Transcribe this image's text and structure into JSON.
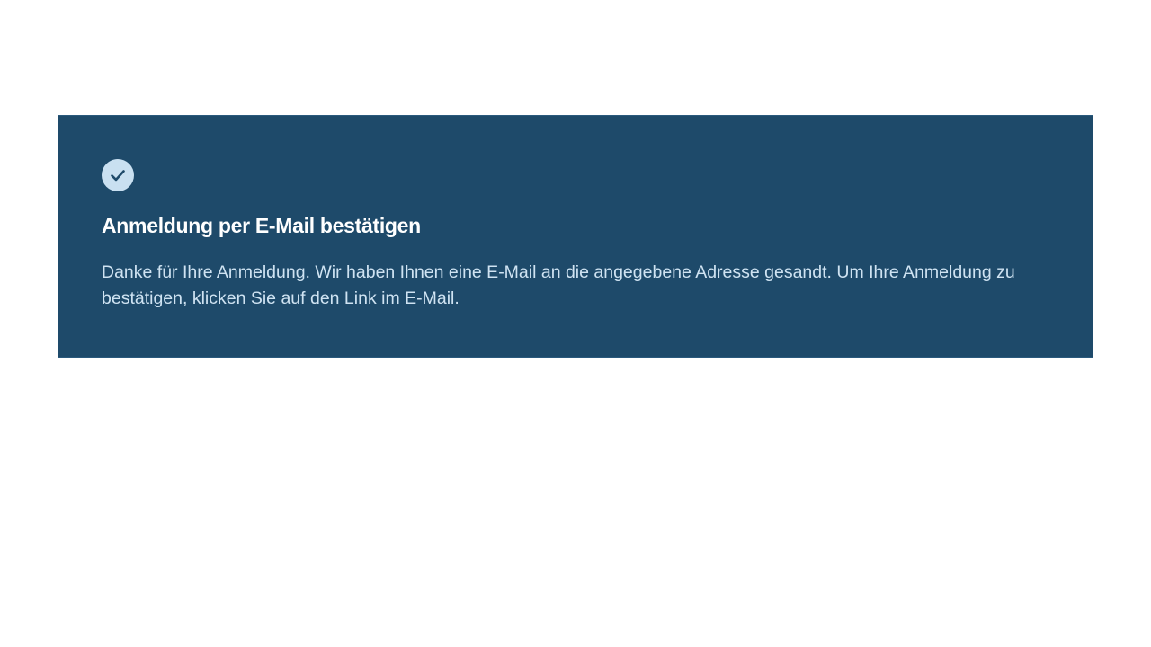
{
  "colors": {
    "banner_background": "#1e4a6a",
    "icon_background": "#c9e0f1",
    "icon_check": "#1e4a6a",
    "title_text": "#ffffff",
    "message_text": "#cfe3f2",
    "page_background": "#ffffff"
  },
  "notice": {
    "icon": "check-icon",
    "title": "Anmeldung per E-Mail bestätigen",
    "message": "Danke für Ihre Anmeldung. Wir haben Ihnen eine E-Mail an die angegebene Adresse gesandt. Um Ihre Anmeldung zu bestätigen, klicken Sie auf den Link im E-Mail."
  }
}
